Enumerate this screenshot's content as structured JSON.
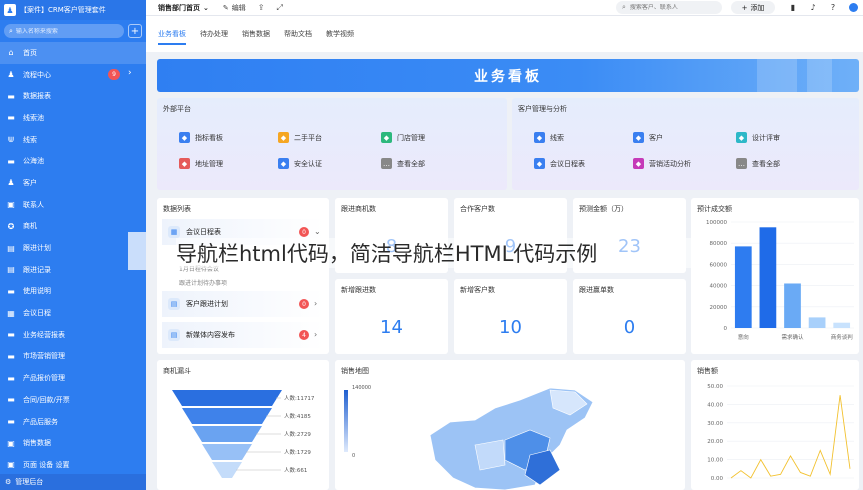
{
  "sidebar": {
    "title": "【案件】CRM客户管理套件",
    "search_placeholder": "输入名称来搜索",
    "items": [
      {
        "label": "首页",
        "icon": "home-icon",
        "glyph": "⌂",
        "active": true
      },
      {
        "label": "流程中心",
        "icon": "user-icon",
        "glyph": "♟",
        "badge": "9",
        "chevron": true
      },
      {
        "label": "数据报表",
        "icon": "folder-icon",
        "glyph": "▬"
      },
      {
        "label": "线索池",
        "icon": "folder-icon",
        "glyph": "▬"
      },
      {
        "label": "线索",
        "icon": "lead-icon",
        "glyph": "⋓"
      },
      {
        "label": "公海池",
        "icon": "folder-icon",
        "glyph": "▬"
      },
      {
        "label": "客户",
        "icon": "user-icon",
        "glyph": "♟"
      },
      {
        "label": "联系人",
        "icon": "contact-icon",
        "glyph": "▣"
      },
      {
        "label": "商机",
        "icon": "opportunity-icon",
        "glyph": "✪"
      },
      {
        "label": "跟进计划",
        "icon": "plan-icon",
        "glyph": "▤"
      },
      {
        "label": "跟进记录",
        "icon": "record-icon",
        "glyph": "▤"
      },
      {
        "label": "使用说明",
        "icon": "folder-icon",
        "glyph": "▬"
      },
      {
        "label": "会议日程",
        "icon": "calendar-icon",
        "glyph": "▦"
      },
      {
        "label": "业务经营报表",
        "icon": "folder-icon",
        "glyph": "▬"
      },
      {
        "label": "市场营销管理",
        "icon": "folder-icon",
        "glyph": "▬"
      },
      {
        "label": "产品报价管理",
        "icon": "folder-icon",
        "glyph": "▬"
      },
      {
        "label": "合同/回款/开票",
        "icon": "folder-icon",
        "glyph": "▬"
      },
      {
        "label": "产品后服务",
        "icon": "folder-icon",
        "glyph": "▬"
      },
      {
        "label": "销售数据",
        "icon": "sales-data-icon",
        "glyph": "▣"
      },
      {
        "label": "页面 设备 设置",
        "icon": "settings-icon",
        "glyph": "▣"
      }
    ],
    "footer": "管理后台"
  },
  "topbar": {
    "dept": "销售部门首页",
    "edit": "编辑",
    "search_placeholder": "搜索客户、联系人",
    "add": "添加"
  },
  "tabs": [
    "业务看板",
    "待办处理",
    "销售数据",
    "帮助文档",
    "教学视频"
  ],
  "banner_title": "业务看板",
  "external": {
    "title": "外部平台",
    "links": [
      {
        "label": "指标看板",
        "color": "#3a7ff0"
      },
      {
        "label": "二手平台",
        "color": "#f5a623"
      },
      {
        "label": "门店管理",
        "color": "#2db87d"
      },
      {
        "label": "地址管理",
        "color": "#e55a5a"
      },
      {
        "label": "安全认证",
        "color": "#3a7ff0"
      },
      {
        "label": "查看全部",
        "color": "#888888"
      }
    ]
  },
  "crm": {
    "title": "客户管理与分析",
    "links": [
      {
        "label": "线索",
        "color": "#3a7ff0"
      },
      {
        "label": "客户",
        "color": "#3a7ff0"
      },
      {
        "label": "设计评审",
        "color": "#2db8c8"
      },
      {
        "label": "会议日程表",
        "color": "#3a7ff0"
      },
      {
        "label": "营销活动分析",
        "color": "#c53ab8"
      },
      {
        "label": "查看全部",
        "color": "#888888"
      }
    ]
  },
  "datalist": {
    "title": "数据列表",
    "rows": [
      {
        "label": "会议日程表",
        "badge": "0"
      },
      {
        "label": "客户跟进计划",
        "badge": "0"
      },
      {
        "label": "新媒体内容发布",
        "badge": "4"
      }
    ],
    "sub1": "1月日程待会议",
    "sub2": "跟进计划待办事项"
  },
  "stats": [
    {
      "title": "跟进商机数",
      "value": "8"
    },
    {
      "title": "合作客户数",
      "value": "9"
    },
    {
      "title": "预测金额（万）",
      "value": "23"
    },
    {
      "title": "新增跟进数",
      "value": "14"
    },
    {
      "title": "新增客户数",
      "value": "10"
    },
    {
      "title": "跟进赢单数",
      "value": "0"
    }
  ],
  "forecast": {
    "title": "预计成交额"
  },
  "funnel": {
    "title": "商机漏斗",
    "labels": [
      "人数:11717",
      "人数:4185",
      "人数:2729",
      "人数:1729",
      "人数:661"
    ]
  },
  "map": {
    "title": "销售地图",
    "scale_max": "140000",
    "scale_min": "0"
  },
  "sales": {
    "title": "销售额"
  },
  "watermark": "导航栏html代码，简洁导航栏HTML代码示例",
  "chart_data": [
    {
      "type": "bar",
      "title": "预计成交额",
      "categories": [
        "意向",
        "",
        "需求确认",
        "",
        "商务谈判"
      ],
      "values": [
        77000,
        95000,
        42000,
        10000,
        5000
      ],
      "ylim": [
        0,
        100000
      ],
      "yticks": [
        0,
        20000,
        40000,
        60000,
        80000,
        100000
      ],
      "colors": [
        "#2e7cf0",
        "#1f6be8",
        "#6aaaf5",
        "#a8d0fb",
        "#c8e2fd"
      ]
    },
    {
      "type": "line",
      "title": "销售额",
      "yticks": [
        "0.00",
        "10.00",
        "20.00",
        "30.00",
        "40.00",
        "50.00"
      ],
      "ylim": [
        0,
        50
      ],
      "values": [
        0,
        4,
        0,
        10,
        1,
        2,
        12,
        3,
        1,
        15,
        2,
        45,
        5
      ]
    }
  ]
}
